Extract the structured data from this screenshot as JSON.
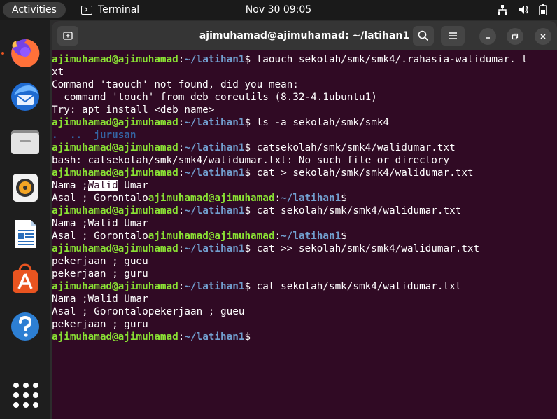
{
  "topbar": {
    "activities": "Activities",
    "app_name": "Terminal",
    "clock": "Nov 30  09:05"
  },
  "window": {
    "title": "ajimuhamad@ajimuhamad: ~/latihan1"
  },
  "prompt": {
    "user_host": "ajimuhamad@ajimuhamad",
    "colon": ":",
    "path": "~/latihan1",
    "dollar": "$"
  },
  "terminal": {
    "cmd1": " taouch sekolah/smk/smk4/.rahasia-walidumar. t",
    "cmd1_wrap": "xt",
    "out1a": "Command 'taouch' not found, did you mean:",
    "out1b": "  command 'touch' from deb coreutils (8.32-4.1ubuntu1)",
    "out1c": "Try: apt install <deb name>",
    "cmd2": " ls -a sekolah/smk/smk4",
    "ls_dot": ".",
    "ls_dotdot": "..",
    "ls_dir": "jurusan",
    "cmd3": " catsekolah/smk/smk4/walidumar.txt",
    "out3": "bash: catsekolah/smk/smk4/walidumar.txt: No such file or directory",
    "cmd4": " cat > sekolah/smk/smk4/walidumar.txt",
    "in4a_pre": "Nama ;",
    "in4a_sel": "Walid",
    "in4a_post": " Umar",
    "in4b": "Asal ; Gorontalo",
    "cmd5": " cat sekolah/smk/smk4/walidumar.txt",
    "out5a": "Nama ;Walid Umar",
    "out5b": "Asal ; Gorontalo",
    "cmd6": " cat >> sekolah/smk/smk4/walidumar.txt",
    "in6a": "pekerjaan ; gueu",
    "in6b": "pekerjaan ; guru",
    "cmd7": " cat sekolah/smk/smk4/walidumar.txt",
    "out7a": "Nama ;Walid Umar",
    "out7b": "Asal ; Gorontalopekerjaan ; gueu",
    "out7c": "pekerjaan ; guru"
  },
  "colors": {
    "terminal_bg": "#300a24",
    "prompt_user": "#8ae234",
    "prompt_path": "#729fcf",
    "dir_listing": "#3465a4",
    "ubuntu_orange": "#e95420"
  },
  "dock": {
    "items": [
      "firefox-icon",
      "thunderbird-icon",
      "files-icon",
      "rhythmbox-icon",
      "libreoffice-writer-icon",
      "ubuntu-software-icon",
      "help-icon",
      "show-apps-icon"
    ]
  }
}
